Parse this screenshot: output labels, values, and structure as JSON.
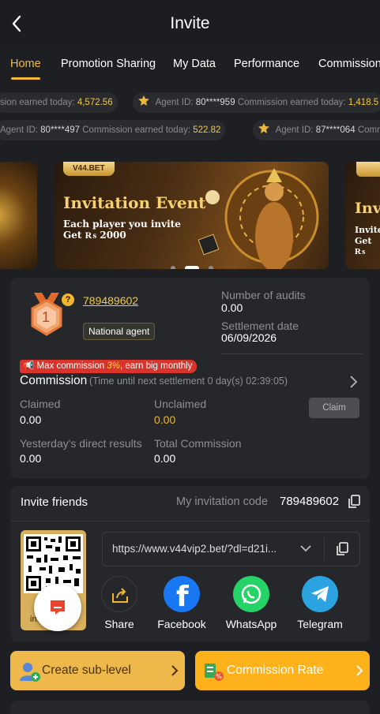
{
  "header": {
    "title": "Invite"
  },
  "tabs": [
    {
      "label": "Home",
      "active": true
    },
    {
      "label": "Promotion Sharing"
    },
    {
      "label": "My Data"
    },
    {
      "label": "Performance"
    },
    {
      "label": "Commission"
    }
  ],
  "ticker1": [
    {
      "prefix": "sion earned today:",
      "value": "4,572.56"
    },
    {
      "agent_label": "Agent ID:",
      "agent_id": "80****959",
      "earn_label": "Commission earned today:",
      "value": "1,418.5"
    }
  ],
  "ticker2": [
    {
      "agent_label": "Agent ID:",
      "agent_id": "80****497",
      "earn_label": "Commission earned today:",
      "value": "522.82"
    },
    {
      "agent_label": "Agent ID:",
      "agent_id": "87****064",
      "earn_label": "Comm"
    }
  ],
  "banner": {
    "brand": "V44.BET",
    "headline": "Invitation Event",
    "line1": "Each player you invite",
    "line2": "Get ₨ 2000",
    "side_headline": "Inv",
    "side_line1": "Invite",
    "side_line2": "Get ₨"
  },
  "agent": {
    "rank": "1",
    "id": "789489602",
    "badge": "National agent",
    "audits_label": "Number of audits",
    "audits_value": "0.00",
    "settlement_label": "Settlement date",
    "settlement_value": "06/09/2026"
  },
  "commission": {
    "promo_prefix": "Max commission",
    "promo_pct": "3%",
    "promo_suffix": ", earn big monthly",
    "title": "Commission",
    "timer": "(Time until next settlement  0 day(s) 02:39:05)",
    "claimed_label": "Claimed",
    "claimed_value": "0.00",
    "unclaimed_label": "Unclaimed",
    "unclaimed_value": "0.00",
    "claim_button": "Claim",
    "yesterday_label": "Yesterday's direct results",
    "yesterday_value": "0.00",
    "total_label": "Total Commission",
    "total_value": "0.00"
  },
  "invite": {
    "title": "Invite friends",
    "code_label": "My invitation code",
    "code_value": "789489602",
    "link": "https://www.v44vip2.bet/?dl=d21i...",
    "qr_caption": "in...",
    "share": [
      {
        "label": "Share"
      },
      {
        "label": "Facebook"
      },
      {
        "label": "WhatsApp"
      },
      {
        "label": "Telegram"
      }
    ]
  },
  "actions": {
    "sublevel": "Create sub-level",
    "rate": "Commission Rate"
  },
  "colors": {
    "accent": "#f5b93b",
    "facebook": "#1877f2",
    "whatsapp": "#25d366",
    "telegram": "#2aa3e0",
    "promo": "#d9342b"
  }
}
